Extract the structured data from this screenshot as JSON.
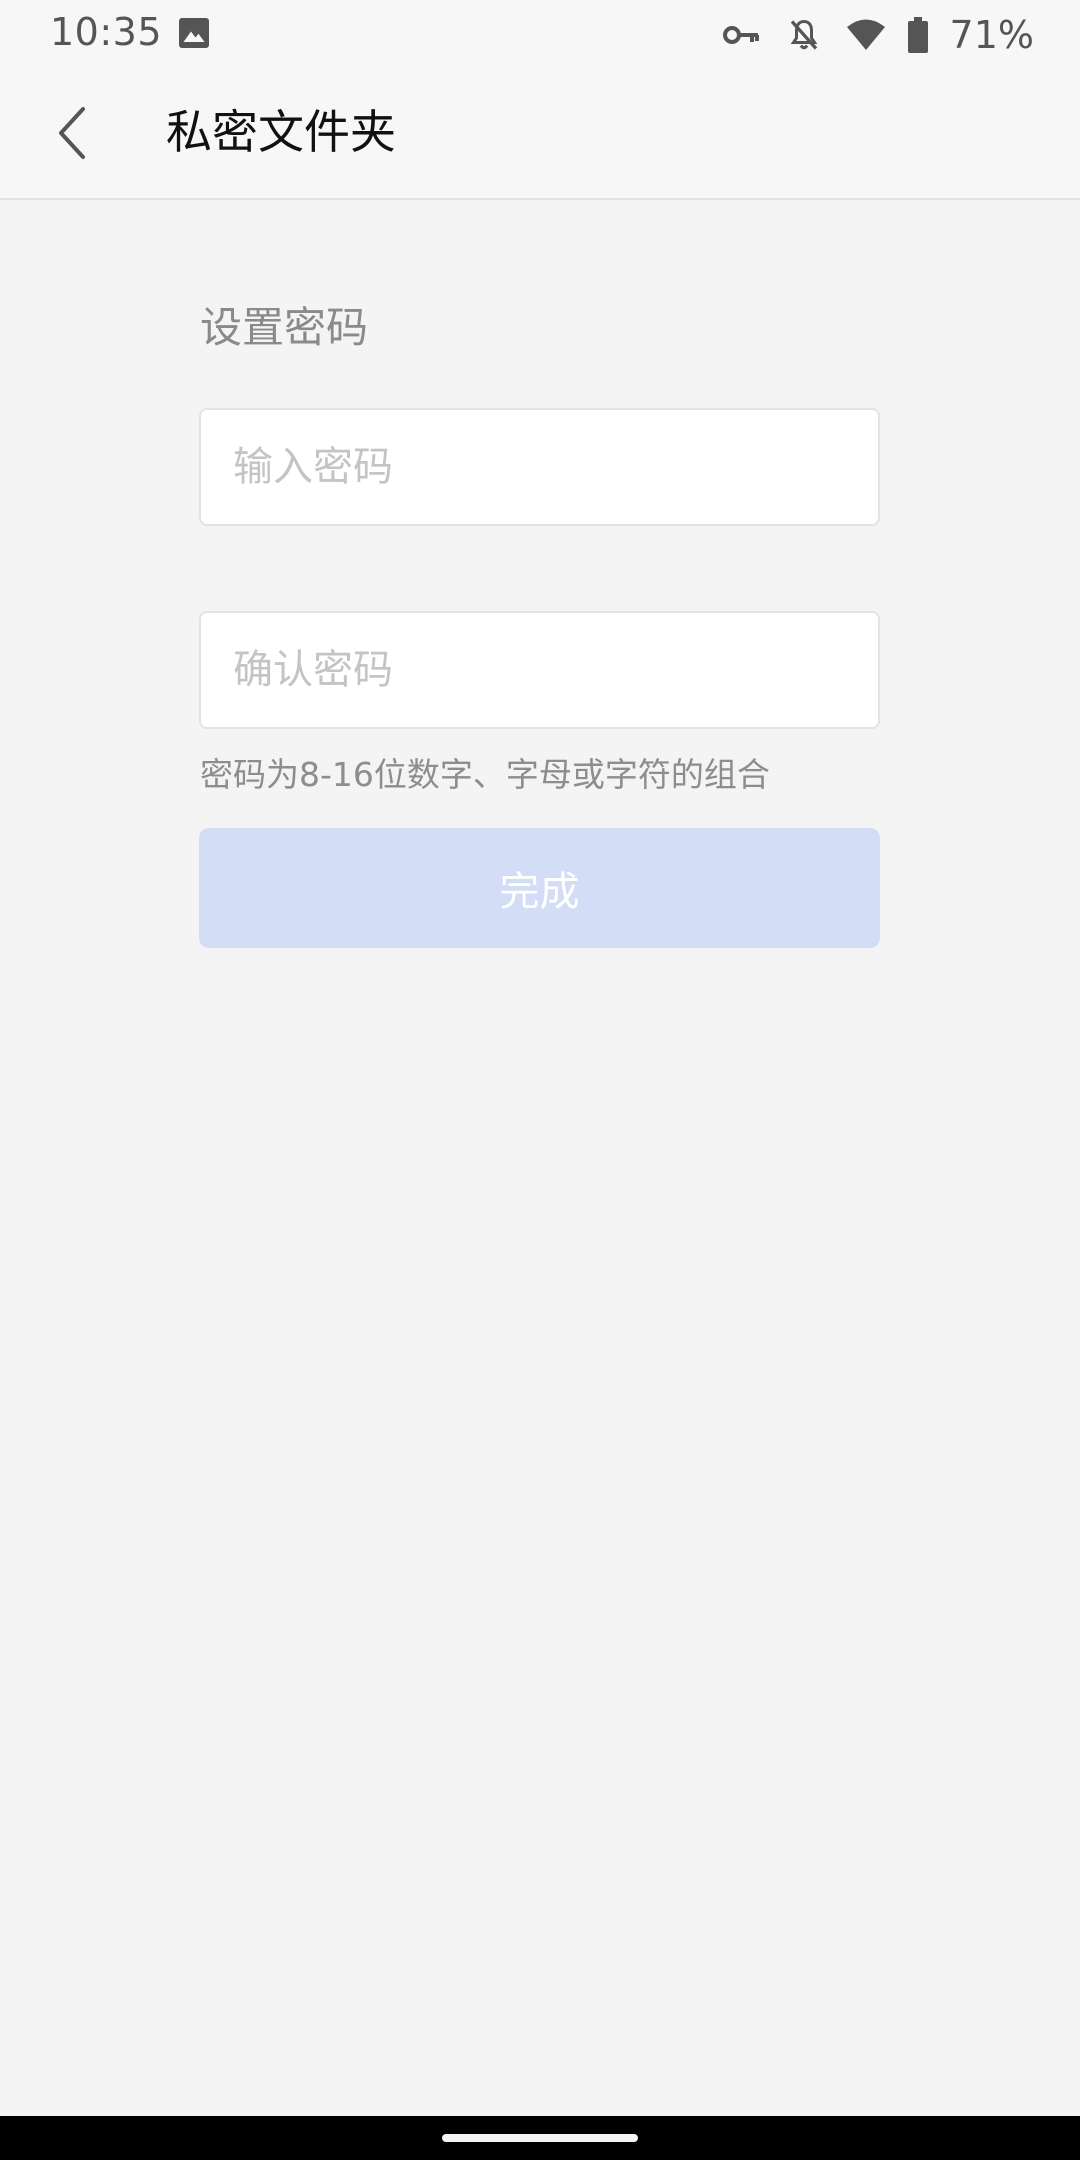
{
  "status_bar": {
    "time": "10:35",
    "battery": "71%",
    "icons": [
      "image-icon",
      "key-icon",
      "bell-off-icon",
      "wifi-icon",
      "battery-icon"
    ]
  },
  "app_bar": {
    "title": "私密文件夹",
    "back_icon": "chevron-left-icon"
  },
  "form": {
    "section_title": "设置密码",
    "password_placeholder": "输入密码",
    "confirm_placeholder": "确认密码",
    "password_value": "",
    "confirm_value": "",
    "hint": "密码为8-16位数字、字母或字符的组合",
    "done_label": "完成"
  },
  "colors": {
    "background": "#f4f4f4",
    "button_disabled": "#d3ddf6",
    "text_gray": "#8a8a8a"
  }
}
